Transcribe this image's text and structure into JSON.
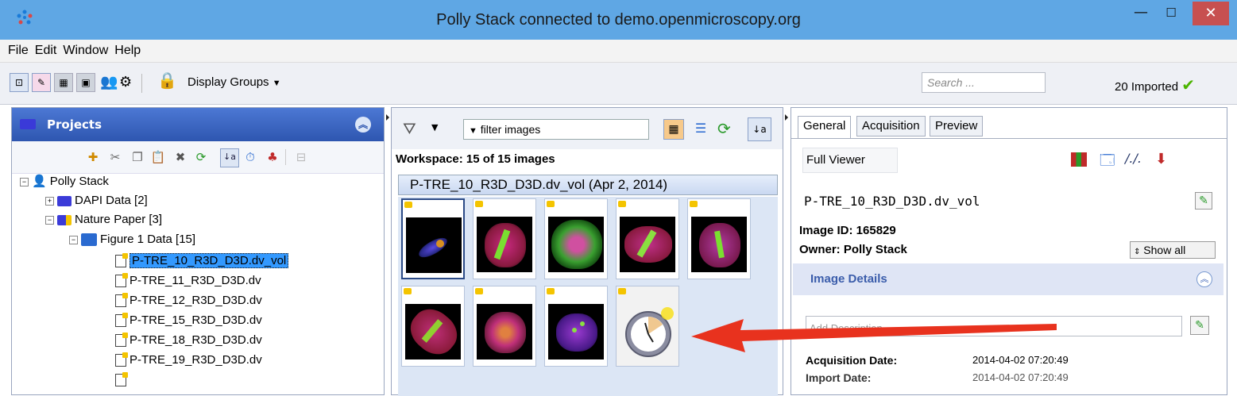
{
  "window": {
    "title": "Polly Stack connected to demo.openmicroscopy.org",
    "minimize_glyph": "—",
    "maximize_glyph": "☐",
    "close_glyph": "✕"
  },
  "menu": [
    "File",
    "Edit",
    "Window",
    "Help"
  ],
  "toolbar": {
    "display_groups_label": "Display Groups",
    "search_placeholder": "Search ...",
    "imported_status": "20 Imported",
    "imported_icon": "check-icon"
  },
  "projects_panel": {
    "title": "Projects",
    "tree": {
      "root": "Polly Stack",
      "items": [
        {
          "label": "DAPI Data [2]"
        },
        {
          "label": "Nature Paper [3]"
        },
        {
          "label": "Figure 1 Data [15]"
        }
      ],
      "images": [
        "P-TRE_10_R3D_D3D.dv_vol",
        "P-TRE_11_R3D_D3D.dv",
        "P-TRE_12_R3D_D3D.dv",
        "P-TRE_15_R3D_D3D.dv",
        "P-TRE_18_R3D_D3D.dv",
        "P-TRE_19_R3D_D3D.dv"
      ]
    }
  },
  "workspace": {
    "filter_text": "filter  images",
    "summary": "Workspace: 15 of 15 images",
    "dataset_header": "P-TRE_10_R3D_D3D.dv_vol (Apr 2, 2014)"
  },
  "details_panel": {
    "tabs": [
      "General",
      "Acquisition",
      "Preview"
    ],
    "active_tab": "General",
    "full_viewer_label": "Full Viewer",
    "image_name": "P-TRE_10_R3D_D3D.dv_vol",
    "image_id": "Image ID: 165829",
    "owner": "Owner: Polly Stack",
    "show_all_label": "Show all",
    "image_details_label": "Image Details",
    "description_placeholder": "Add Description",
    "acquisition_date_label": "Acquisition Date:",
    "acquisition_date_value": "2014-04-02 07:20:49",
    "import_date_label": "Import Date:",
    "import_date_value": "2014-04-02 07:20:49"
  },
  "colors": {
    "titlebar": "#5fa7e4",
    "close_button": "#c75050",
    "selection": "#3399ff",
    "annotation_arrow": "#e8321e"
  }
}
